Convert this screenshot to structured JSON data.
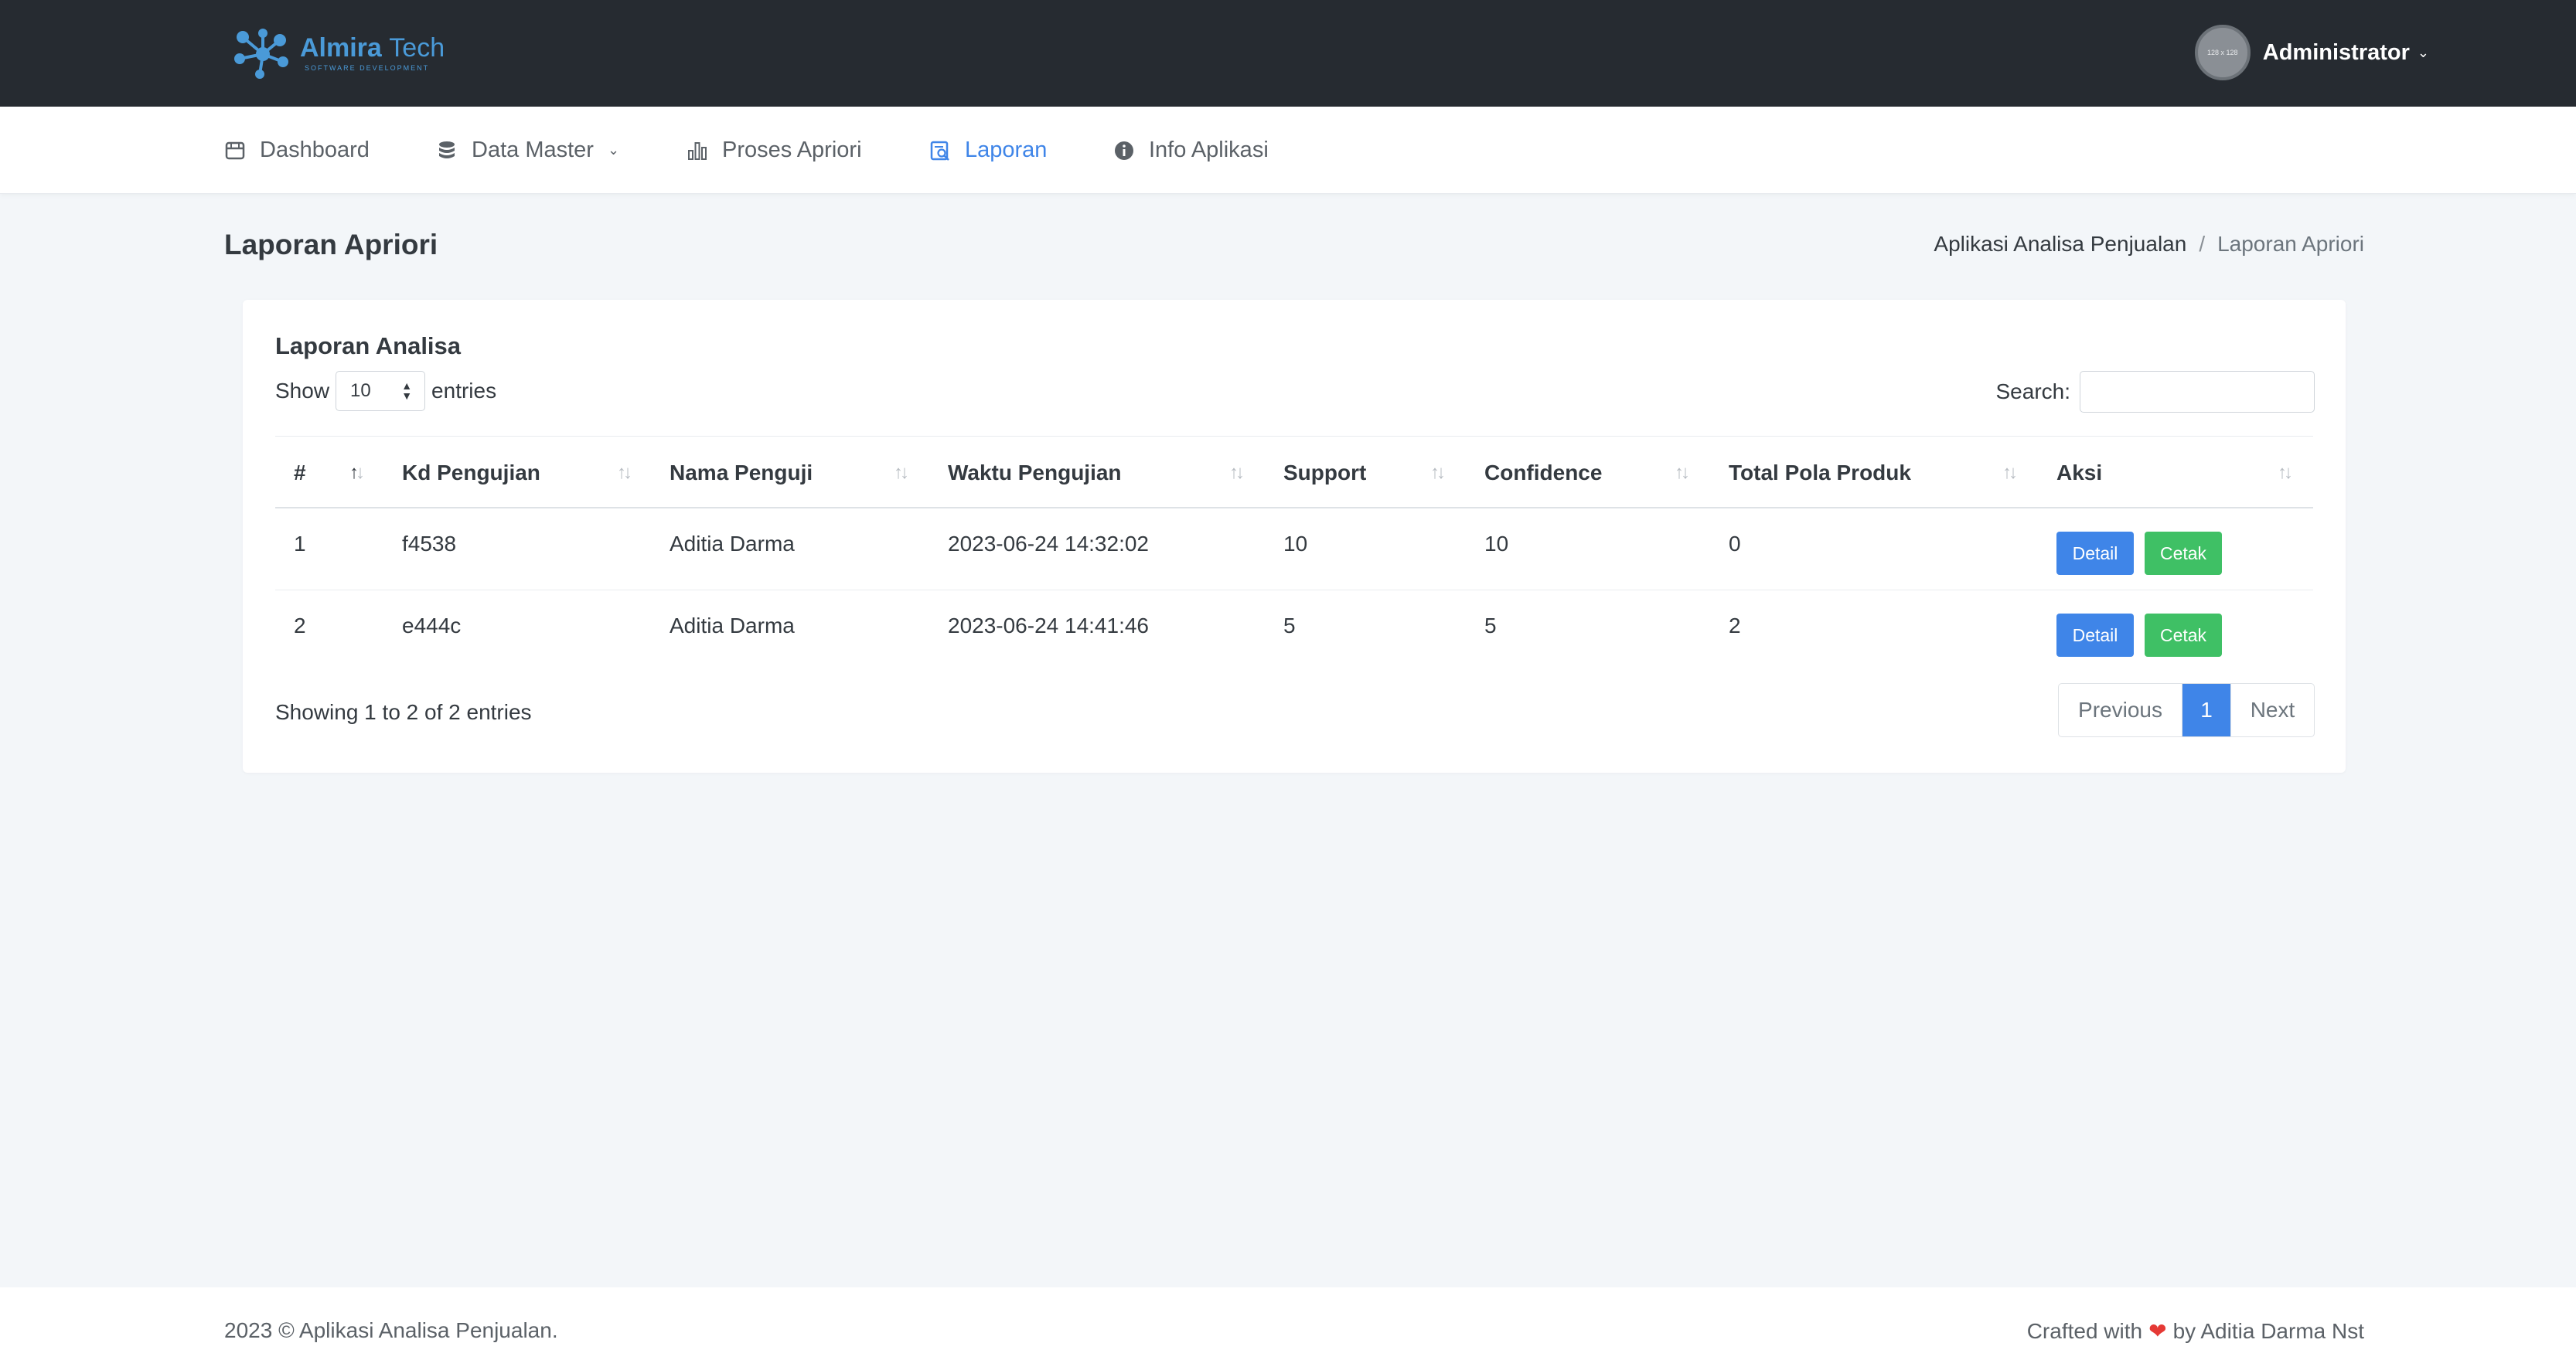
{
  "header": {
    "brand_name": "Almira",
    "brand_name_2": "Tech",
    "brand_tagline": "SOFTWARE DEVELOPMENT",
    "avatar_text": "128 x 128",
    "user_name": "Administrator"
  },
  "nav": {
    "items": [
      {
        "label": "Dashboard",
        "icon": "calendar-icon"
      },
      {
        "label": "Data Master",
        "icon": "database-icon"
      },
      {
        "label": "Proses Apriori",
        "icon": "bar-chart-icon"
      },
      {
        "label": "Laporan",
        "icon": "report-search-icon",
        "active": true
      },
      {
        "label": "Info Aplikasi",
        "icon": "info-icon"
      }
    ]
  },
  "page": {
    "title": "Laporan Apriori",
    "breadcrumb_home": "Aplikasi Analisa Penjualan",
    "breadcrumb_separator": "/",
    "breadcrumb_current": "Laporan Apriori"
  },
  "card": {
    "title": "Laporan Analisa",
    "show_label": "Show",
    "entries_value": "10",
    "entries_label": "entries",
    "search_label": "Search:",
    "search_value": ""
  },
  "table": {
    "columns": [
      "#",
      "Kd Pengujian",
      "Nama Penguji",
      "Waktu Pengujian",
      "Support",
      "Confidence",
      "Total Pola Produk",
      "Aksi"
    ],
    "rows": [
      {
        "no": "1",
        "kd": "f4538",
        "nama": "Aditia Darma",
        "waktu": "2023-06-24 14:32:02",
        "support": "10",
        "confidence": "10",
        "total": "0"
      },
      {
        "no": "2",
        "kd": "e444c",
        "nama": "Aditia Darma",
        "waktu": "2023-06-24 14:41:46",
        "support": "5",
        "confidence": "5",
        "total": "2"
      }
    ],
    "detail_label": "Detail",
    "cetak_label": "Cetak"
  },
  "pagination": {
    "info": "Showing 1 to 2 of 2 entries",
    "previous": "Previous",
    "current_page": "1",
    "next": "Next"
  },
  "footer": {
    "left": "2023 © Aplikasi Analisa Penjualan.",
    "right_prefix": "Crafted with",
    "right_suffix": "by Aditia Darma Nst"
  },
  "colors": {
    "header_bg": "#262b31",
    "accent": "#3f85e8",
    "success": "#3fc065",
    "page_bg": "#f3f6f9"
  }
}
